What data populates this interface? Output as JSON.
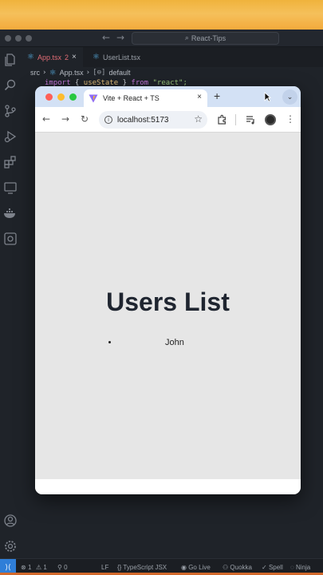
{
  "vscode": {
    "search_text": "React-Tips",
    "tabs": [
      {
        "label": "App.tsx",
        "badge": "2",
        "close": "×"
      },
      {
        "label": "UserList.tsx"
      }
    ],
    "breadcrumb": {
      "folder": "src",
      "file": "App.tsx",
      "symbol": "default"
    },
    "code": {
      "kw1": "import",
      "brace_open": "{",
      "ident": "useState",
      "brace_close": "}",
      "kw2": "from",
      "str": "\"react\";"
    },
    "status": {
      "errors": "1",
      "warnings": "1",
      "ports": "0",
      "eol": "LF",
      "language": "TypeScript JSX",
      "go_live": "Go Live",
      "quokka": "Quokka",
      "spell": "Spell",
      "ninja": "Ninja"
    }
  },
  "browser": {
    "tab_title": "Vite + React + TS",
    "tab_close": "×",
    "new_tab": "+",
    "url": "localhost:5173",
    "page": {
      "heading": "Users List",
      "users": [
        "John"
      ]
    }
  },
  "colors": {
    "accent_blue": "#2f7ed8",
    "error_red": "#e06c75",
    "tab_strip": "#d3e1f5",
    "heading": "#1f2530"
  }
}
